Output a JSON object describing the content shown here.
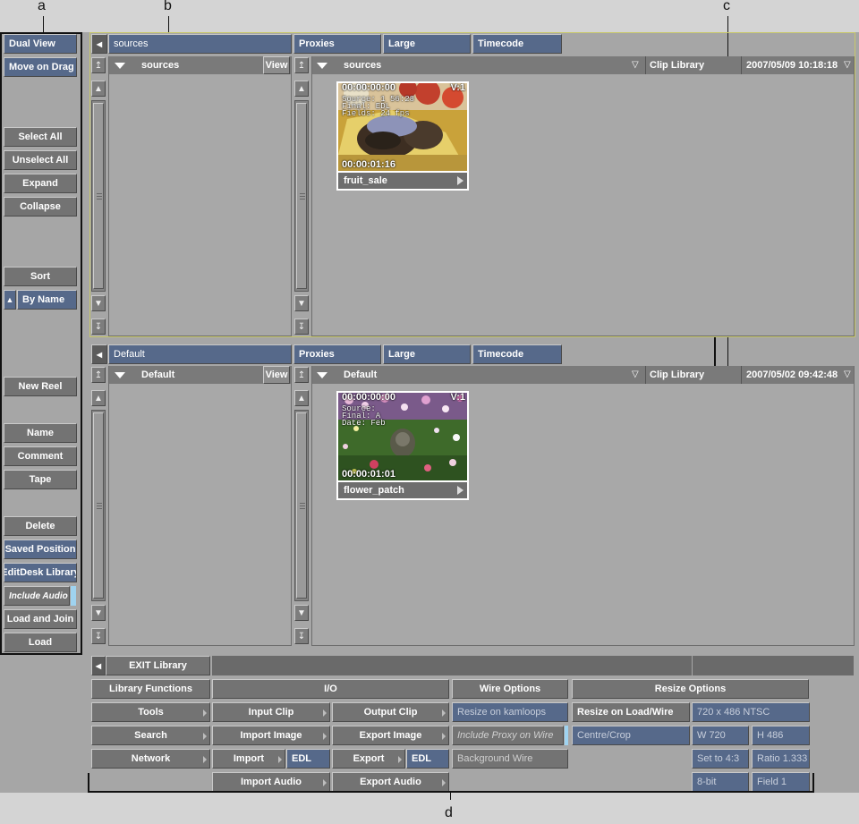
{
  "callouts": {
    "a": "a",
    "b": "b",
    "c": "c",
    "d": "d"
  },
  "sidebar": {
    "dual_view": "Dual View",
    "move_on_drag": "Move on Drag",
    "select_all": "Select All",
    "unselect_all": "Unselect All",
    "expand": "Expand",
    "collapse": "Collapse",
    "sort": "Sort",
    "by_name": "By Name",
    "new_reel": "New Reel",
    "name": "Name",
    "comment": "Comment",
    "tape": "Tape",
    "delete": "Delete",
    "saved_position": "Saved Position",
    "editdesk_library": "EditDesk Library",
    "include_audio": "Include Audio",
    "load_and_join": "Load and Join",
    "load": "Load"
  },
  "top_panel": {
    "library_field": "sources",
    "proxies": "Proxies",
    "large": "Large",
    "timecode": "Timecode",
    "tree_reel": "sources",
    "view": "View",
    "reel": "sources",
    "clip_library": "Clip Library",
    "datetime": "2007/05/09 10:18:18",
    "clip": {
      "name": "fruit_sale",
      "tc_start": "00:00:00:00",
      "tc_end": "00:00:01:16",
      "track": "V:1",
      "info": [
        "Source: 1 56:28",
        "Final: EDL",
        "Fields: 24 fps"
      ]
    }
  },
  "bottom_panel": {
    "library_field": "Default",
    "proxies": "Proxies",
    "large": "Large",
    "timecode": "Timecode",
    "tree_reel": "Default",
    "view": "View",
    "reel": "Default",
    "clip_library": "Clip Library",
    "datetime": "2007/05/02 09:42:48",
    "clip": {
      "name": "flower_patch",
      "tc_start": "00:00:00:00",
      "tc_end": "00:00:01:01",
      "track": "V:1",
      "info": [
        "Source:",
        "Final: A",
        "Date: Feb"
      ]
    }
  },
  "bottom": {
    "exit_library": "EXIT Library",
    "library_functions": "Library Functions",
    "io": "I/O",
    "wire_options": "Wire Options",
    "resize_options": "Resize Options",
    "tools": "Tools",
    "search": "Search",
    "network": "Network",
    "input_clip": "Input Clip",
    "import_image": "Import Image",
    "import": "Import",
    "import_edl": "EDL",
    "import_audio": "Import Audio",
    "output_clip": "Output Clip",
    "export_image": "Export Image",
    "export": "Export",
    "export_edl": "EDL",
    "export_audio": "Export Audio",
    "resize_on_kamloops": "Resize on kamloops",
    "include_proxy_on_wire": "Include Proxy on Wire",
    "background_wire": "Background Wire",
    "resize_on_load_wire": "Resize on Load/Wire",
    "centre_crop": "Centre/Crop",
    "resolution": "720 x 486 NTSC",
    "width": "W 720",
    "height": "H 486",
    "set_to_43": "Set to 4:3",
    "ratio": "Ratio 1.333",
    "bit_depth": "8-bit",
    "field": "Field 1"
  }
}
